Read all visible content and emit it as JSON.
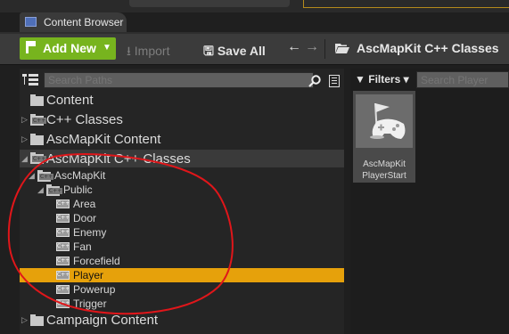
{
  "tab": {
    "title": "Content Browser"
  },
  "toolbar": {
    "add_new": "Add New",
    "import": "Import",
    "save_all": "Save All",
    "path_current": "AscMapKit C++ Classes"
  },
  "left_panel": {
    "search_placeholder": "Search Paths",
    "tree": {
      "content": "Content",
      "cpp_classes": "C++ Classes",
      "ascmapkit_content": "AscMapKit Content",
      "ascmapkit_cpp_classes": "AscMapKit C++ Classes",
      "ascmapkit": "AscMapKit",
      "public": "Public",
      "classes": [
        "Area",
        "Door",
        "Enemy",
        "Fan",
        "Forcefield",
        "Player",
        "Powerup",
        "Trigger"
      ],
      "campaign_content": "Campaign Content"
    },
    "selected_class": "Player"
  },
  "right_panel": {
    "filters": "Filters",
    "search_placeholder": "Search Player",
    "asset_name_line1": "AscMapKit",
    "asset_name_line2": "PlayerStart"
  },
  "colors": {
    "accent_green": "#77b41e",
    "selection_orange": "#e6a10b",
    "annotation_red": "#e0161a"
  }
}
